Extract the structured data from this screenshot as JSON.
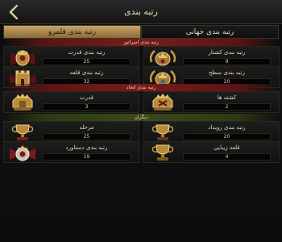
{
  "header": {
    "title": "رتبه بندی"
  },
  "tabs": [
    {
      "label": "رتبه بندی جهانی",
      "active": false
    },
    {
      "label": "رتبه بندی قلمرو",
      "active": true
    }
  ],
  "sections": {
    "emperor": {
      "title": "رتبه بندی امپراتور"
    },
    "alliance": {
      "title": "رتبه بندی اتحاد"
    },
    "others": {
      "title": "دیگران"
    }
  },
  "cards": {
    "kill_rank": {
      "label": "رتبه بندی کشتار",
      "value": "9"
    },
    "power_rank": {
      "label": "رتبه بندی قدرت",
      "value": "25"
    },
    "level_rank": {
      "label": "رتبه بندی سطح",
      "value": "20"
    },
    "castle_rank": {
      "label": "رتبه بندی قلعه",
      "value": "32"
    },
    "alliance_kills": {
      "label": "کشته ها",
      "value": "2"
    },
    "alliance_power": {
      "label": "قدرت",
      "value": "3"
    },
    "event_rank": {
      "label": "رتبه بندی رویداد",
      "value": "20"
    },
    "stage": {
      "label": "مرحله",
      "value": "25"
    },
    "beauty_castle": {
      "label": "قلعه زیبایی",
      "value": "4"
    },
    "achievement_rank": {
      "label": "رتبه بندی دستاورد",
      "value": "19"
    }
  },
  "colors": {
    "accent_gold": "#c7a468",
    "section_red": "#7a1c1c",
    "section_green": "#3a4a1c"
  }
}
